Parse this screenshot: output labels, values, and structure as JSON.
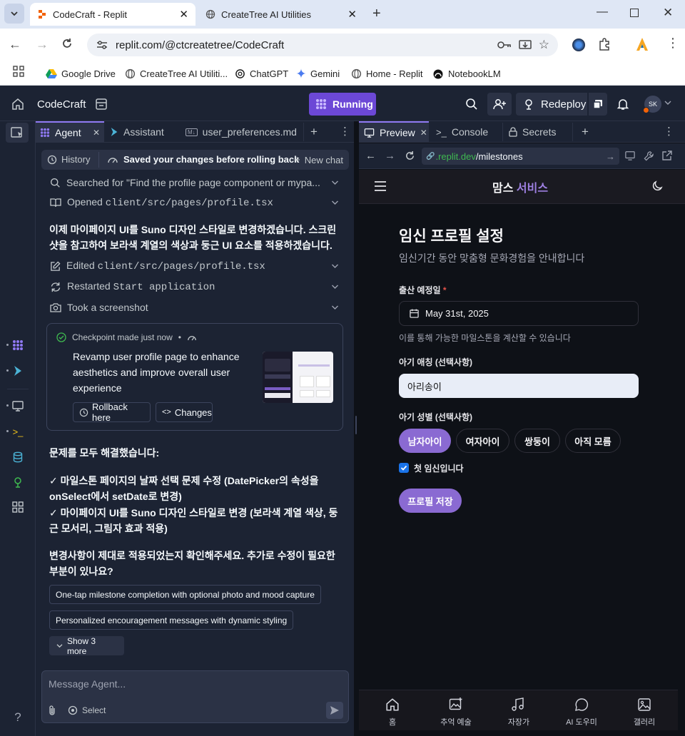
{
  "browser": {
    "tabs": [
      {
        "title": "CodeCraft - Replit",
        "active": true
      },
      {
        "title": "CreateTree AI Utilities",
        "active": false
      }
    ],
    "url": "replit.com/@ctcreatetree/CodeCraft",
    "bookmarks": [
      "Google Drive",
      "CreateTree AI Utiliti...",
      "ChatGPT",
      "Gemini",
      "Home - Replit",
      "NotebookLM"
    ]
  },
  "header": {
    "project": "CodeCraft",
    "run_status": "Running",
    "redeploy": "Redeploy",
    "avatar": "SK"
  },
  "agent": {
    "tabs": [
      "Agent",
      "Assistant",
      "user_preferences.md"
    ],
    "history": "History",
    "saved_status": "Saved your changes before rolling back",
    "new_chat": "New chat",
    "steps": [
      {
        "label": "Searched for \"Find the profile page component or mypa...",
        "code": ""
      },
      {
        "label": "Opened ",
        "code": "client/src/pages/profile.tsx"
      }
    ],
    "message1": "이제 마이페이지 UI를 Suno 디자인 스타일로 변경하겠습니다. 스크린샷을 참고하여 보라색 계열의 색상과 둥근 UI 요소를 적용하겠습니다.",
    "steps2": [
      {
        "label": "Edited ",
        "code": "client/src/pages/profile.tsx"
      },
      {
        "label": "Restarted ",
        "code": "Start application"
      },
      {
        "label": "Took a screenshot",
        "code": ""
      }
    ],
    "checkpoint": {
      "status": "Checkpoint made just now",
      "sep": "•",
      "description": "Revamp user profile page to enhance aesthetics and improve overall user experience",
      "rollback": "Rollback here",
      "changes": "Changes"
    },
    "summary_title": "문제를 모두 해결했습니다:",
    "summary_items": [
      "✓ 마일스톤 페이지의 날짜 선택 문제 수정 (DatePicker의 속성을 onSelect에서 setDate로 변경)",
      "✓ 마이페이지 UI를 Suno 디자인 스타일로 변경 (보라색 계열 색상, 둥근 모서리, 그림자 효과 적용)"
    ],
    "question": "변경사항이 제대로 적용되었는지 확인해주세요. 추가로 수정이 필요한 부분이 있나요?",
    "suggestions": [
      "One-tap milestone completion with optional photo and mood capture",
      "Personalized encouragement messages with dynamic styling"
    ],
    "show_more": "Show 3 more",
    "input_placeholder": "Message Agent...",
    "select": "Select"
  },
  "preview": {
    "tabs": [
      "Preview",
      "Console",
      "Secrets"
    ],
    "url_host": ".replit.dev",
    "url_path": "/milestones",
    "app": {
      "brand_1": "맘스",
      "brand_2": "서비스",
      "title": "임신 프로필 설정",
      "subtitle": "임신기간 동안 맞춤형 문화경험을 안내합니다",
      "due_label": "출산 예정일",
      "required_mark": "*",
      "due_value": "May 31st, 2025",
      "due_help": "이를 통해 가능한 마일스톤을 계산할 수 있습니다",
      "nick_label": "아기 애칭 (선택사항)",
      "nick_value": "아리송이",
      "gender_label": "아기 성별 (선택사항)",
      "genders": [
        "남자아이",
        "여자아이",
        "쌍둥이",
        "아직 모름"
      ],
      "first_preg": "첫 임신입니다",
      "save": "프로필 저장",
      "nav": [
        "홈",
        "추억 예술",
        "자장가",
        "AI 도우미",
        "갤러리"
      ]
    }
  },
  "colors": {
    "purple": "#7a5cc4",
    "bg": "#1c2333",
    "preview_bg": "#0e1117"
  }
}
